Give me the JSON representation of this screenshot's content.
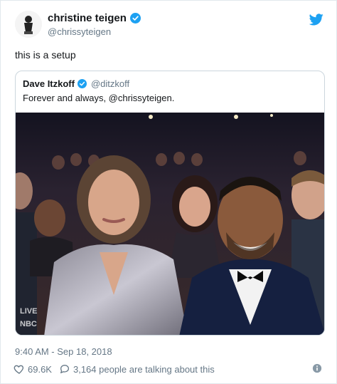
{
  "tweet": {
    "author_name": "christine teigen",
    "author_handle": "@chrissyteigen",
    "text": "this is a setup",
    "timestamp": "9:40 AM - Sep 18, 2018",
    "likes": "69.6K",
    "conversation": "3,164 people are talking about this"
  },
  "quoted": {
    "author_name": "Dave Itzkoff",
    "author_handle": "@ditzkoff",
    "text": "Forever and always, @chrissyteigen.",
    "photo_overlay": "LIVE NBC"
  },
  "colors": {
    "verified": "#1da1f2",
    "bird": "#1da1f2",
    "muted": "#657786",
    "border": "#ccd6dd"
  },
  "icons": [
    "twitter-bird-icon",
    "verified-badge-icon",
    "heart-icon",
    "reply-bubble-icon",
    "info-icon"
  ]
}
